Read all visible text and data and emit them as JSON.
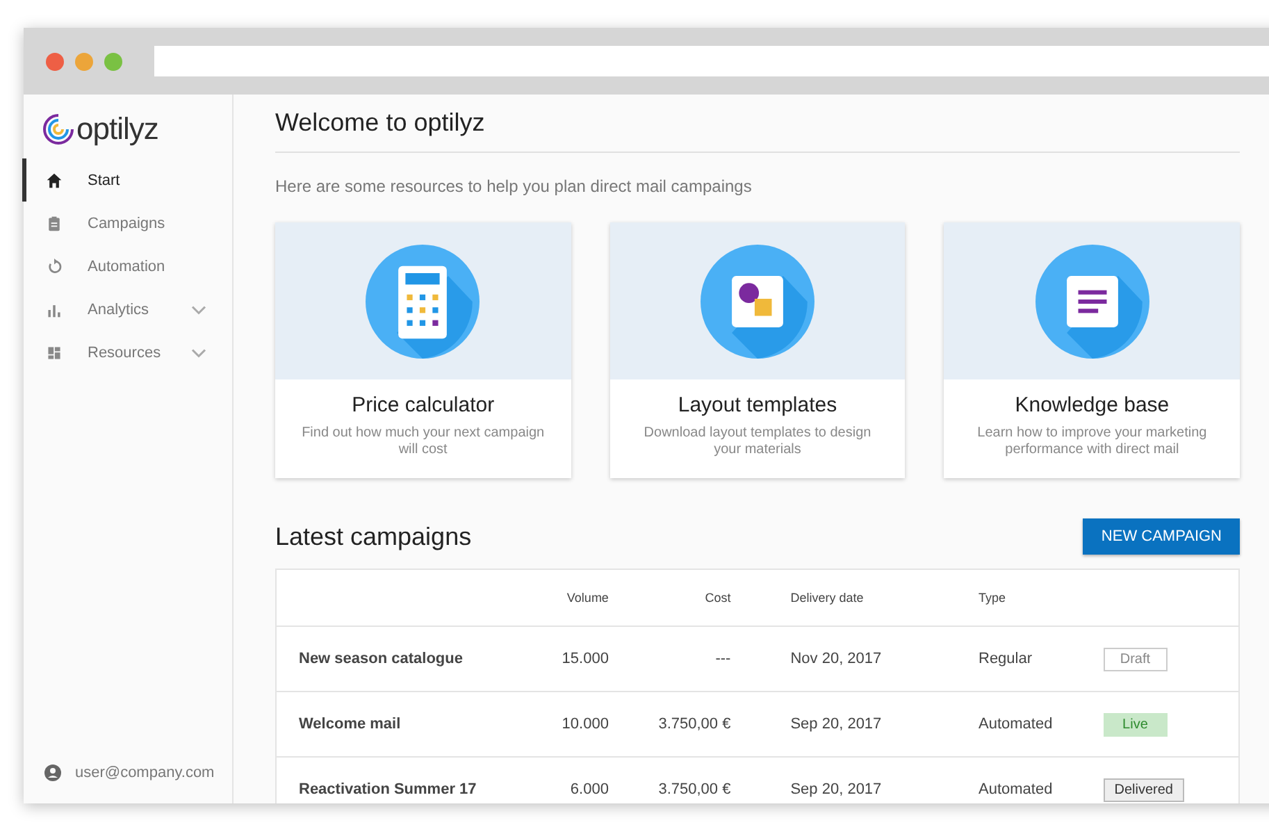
{
  "logo": {
    "text": "optilyz"
  },
  "sidebar": {
    "items": [
      {
        "label": "Start",
        "kind": "home",
        "selected": true,
        "expandable": false
      },
      {
        "label": "Campaigns",
        "kind": "clipboard",
        "selected": false,
        "expandable": false
      },
      {
        "label": "Automation",
        "kind": "refresh",
        "selected": false,
        "expandable": false
      },
      {
        "label": "Analytics",
        "kind": "bars",
        "selected": false,
        "expandable": true
      },
      {
        "label": "Resources",
        "kind": "dashboard",
        "selected": false,
        "expandable": true
      }
    ],
    "user": "user@company.com"
  },
  "title": "Welcome to optilyz",
  "subtitle": "Here are some resources to help you plan direct mail campaings",
  "cards": [
    {
      "kind": "calculator",
      "title": "Price calculator",
      "text": "Find out how much your next campaign will cost"
    },
    {
      "kind": "templates",
      "title": "Layout templates",
      "text": "Download layout templates to design your materials"
    },
    {
      "kind": "knowledge",
      "title": "Knowledge base",
      "text": "Learn how to improve your marketing performance with direct mail"
    }
  ],
  "campaigns": {
    "title": "Latest campaigns",
    "button": "NEW CAMPAIGN",
    "columns": [
      "Volume",
      "Cost",
      "Delivery date",
      "Type"
    ],
    "rows": [
      {
        "name": "New season catalogue",
        "volume": "15.000",
        "cost": "---",
        "date": "Nov 20, 2017",
        "type": "Regular",
        "status": {
          "kind": "draft",
          "label": "Draft"
        }
      },
      {
        "name": "Welcome mail",
        "volume": "10.000",
        "cost": "3.750,00 €",
        "date": "Sep 20, 2017",
        "type": "Automated",
        "status": {
          "kind": "live",
          "label": "Live"
        }
      },
      {
        "name": "Reactivation Summer 17",
        "volume": "6.000",
        "cost": "3.750,00 €",
        "date": "Sep 20, 2017",
        "type": "Automated",
        "status": {
          "kind": "delivered",
          "label": "Delivered"
        }
      }
    ]
  }
}
